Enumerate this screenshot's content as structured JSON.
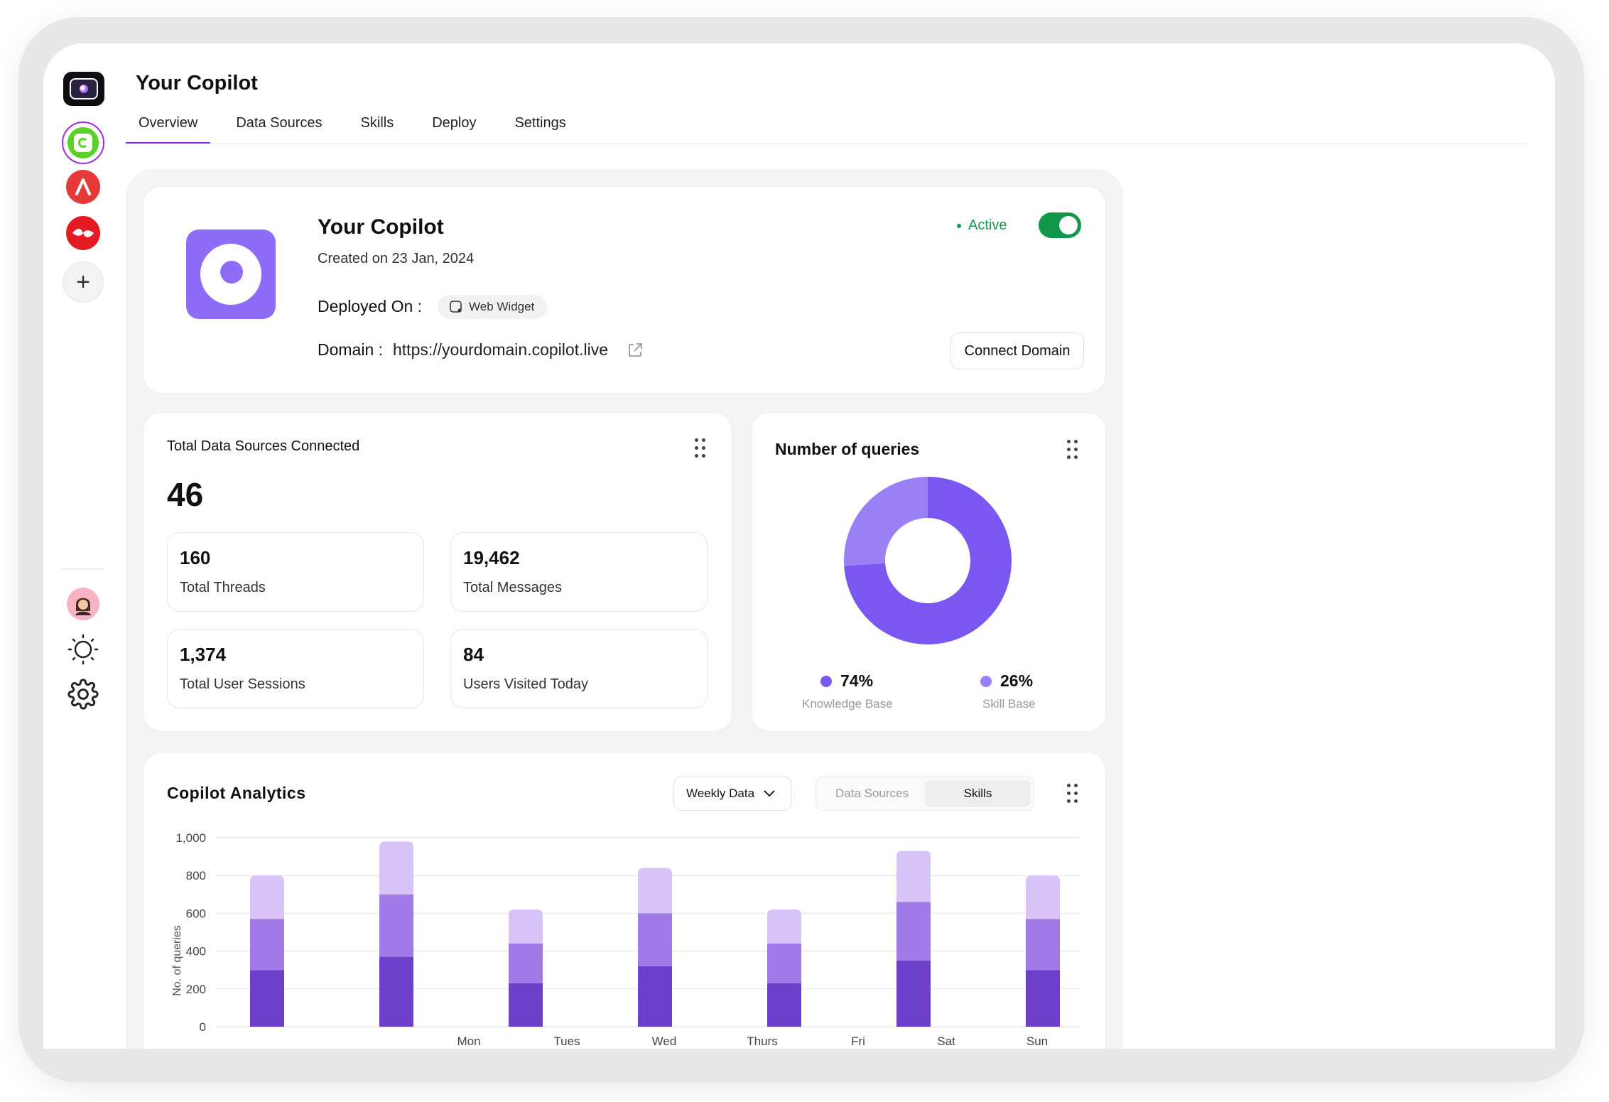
{
  "app": {
    "title": "Your Copilot"
  },
  "tabs": [
    {
      "label": "Overview",
      "active": true
    },
    {
      "label": "Data Sources",
      "active": false
    },
    {
      "label": "Skills",
      "active": false
    },
    {
      "label": "Deploy",
      "active": false
    },
    {
      "label": "Settings",
      "active": false
    }
  ],
  "rail": {
    "icons": [
      "copilot-app-icon",
      "red-a-app-icon",
      "red-wave-app-icon",
      "plus-icon",
      "avatar",
      "sun-icon",
      "gear-icon"
    ]
  },
  "copilot": {
    "name": "Your Copilot",
    "created": "Created on 23 Jan, 2024",
    "deployed_label": "Deployed On :",
    "deployed_chip": "Web Widget",
    "domain_label": "Domain :",
    "domain": "https://yourdomain.copilot.live",
    "status": "Active",
    "status_color": "#14984e",
    "toggle_on": true,
    "connect_label": "Connect Domain"
  },
  "stats": {
    "title": "Total Data Sources Connected",
    "total": "46",
    "items": [
      {
        "value": "160",
        "label": "Total Threads"
      },
      {
        "value": "19,462",
        "label": "Total Messages"
      },
      {
        "value": "1,374",
        "label": "Total User Sessions"
      },
      {
        "value": "84",
        "label": "Users Visited Today"
      }
    ]
  },
  "queries": {
    "title": "Number of queries",
    "slices": [
      {
        "pct": "74%",
        "value": 74,
        "label": "Knowledge Base",
        "color": "#7b57f2"
      },
      {
        "pct": "26%",
        "value": 26,
        "label": "Skill Base",
        "color": "#9a80f5"
      }
    ]
  },
  "analytics": {
    "title": "Copilot Analytics",
    "dropdown_value": "Weekly Data",
    "segments": [
      {
        "label": "Data Sources",
        "active": false
      },
      {
        "label": "Skills",
        "active": true
      }
    ]
  },
  "chart_data": {
    "type": "bar",
    "stacked": true,
    "ylabel": "No. of queries",
    "ylim": [
      0,
      1000
    ],
    "yticks": [
      "0",
      "200",
      "400",
      "600",
      "800",
      "1,000"
    ],
    "xtick_labels": [
      "Mon",
      "Tues",
      "Wed",
      "Thurs",
      "Fri",
      "Sat",
      "Sun"
    ],
    "bars": [
      {
        "total": 800,
        "segments": [
          300,
          270,
          230
        ]
      },
      {
        "total": 980,
        "segments": [
          370,
          330,
          280
        ]
      },
      {
        "total": 620,
        "segments": [
          230,
          210,
          180
        ]
      },
      {
        "total": 840,
        "segments": [
          320,
          280,
          240
        ]
      },
      {
        "total": 620,
        "segments": [
          230,
          210,
          180
        ]
      },
      {
        "total": 930,
        "segments": [
          350,
          310,
          270
        ]
      },
      {
        "total": 800,
        "segments": [
          300,
          270,
          230
        ]
      }
    ],
    "colors": [
      "#6d3fcb",
      "#a27ae8",
      "#d7c3f6"
    ],
    "grid": true
  }
}
